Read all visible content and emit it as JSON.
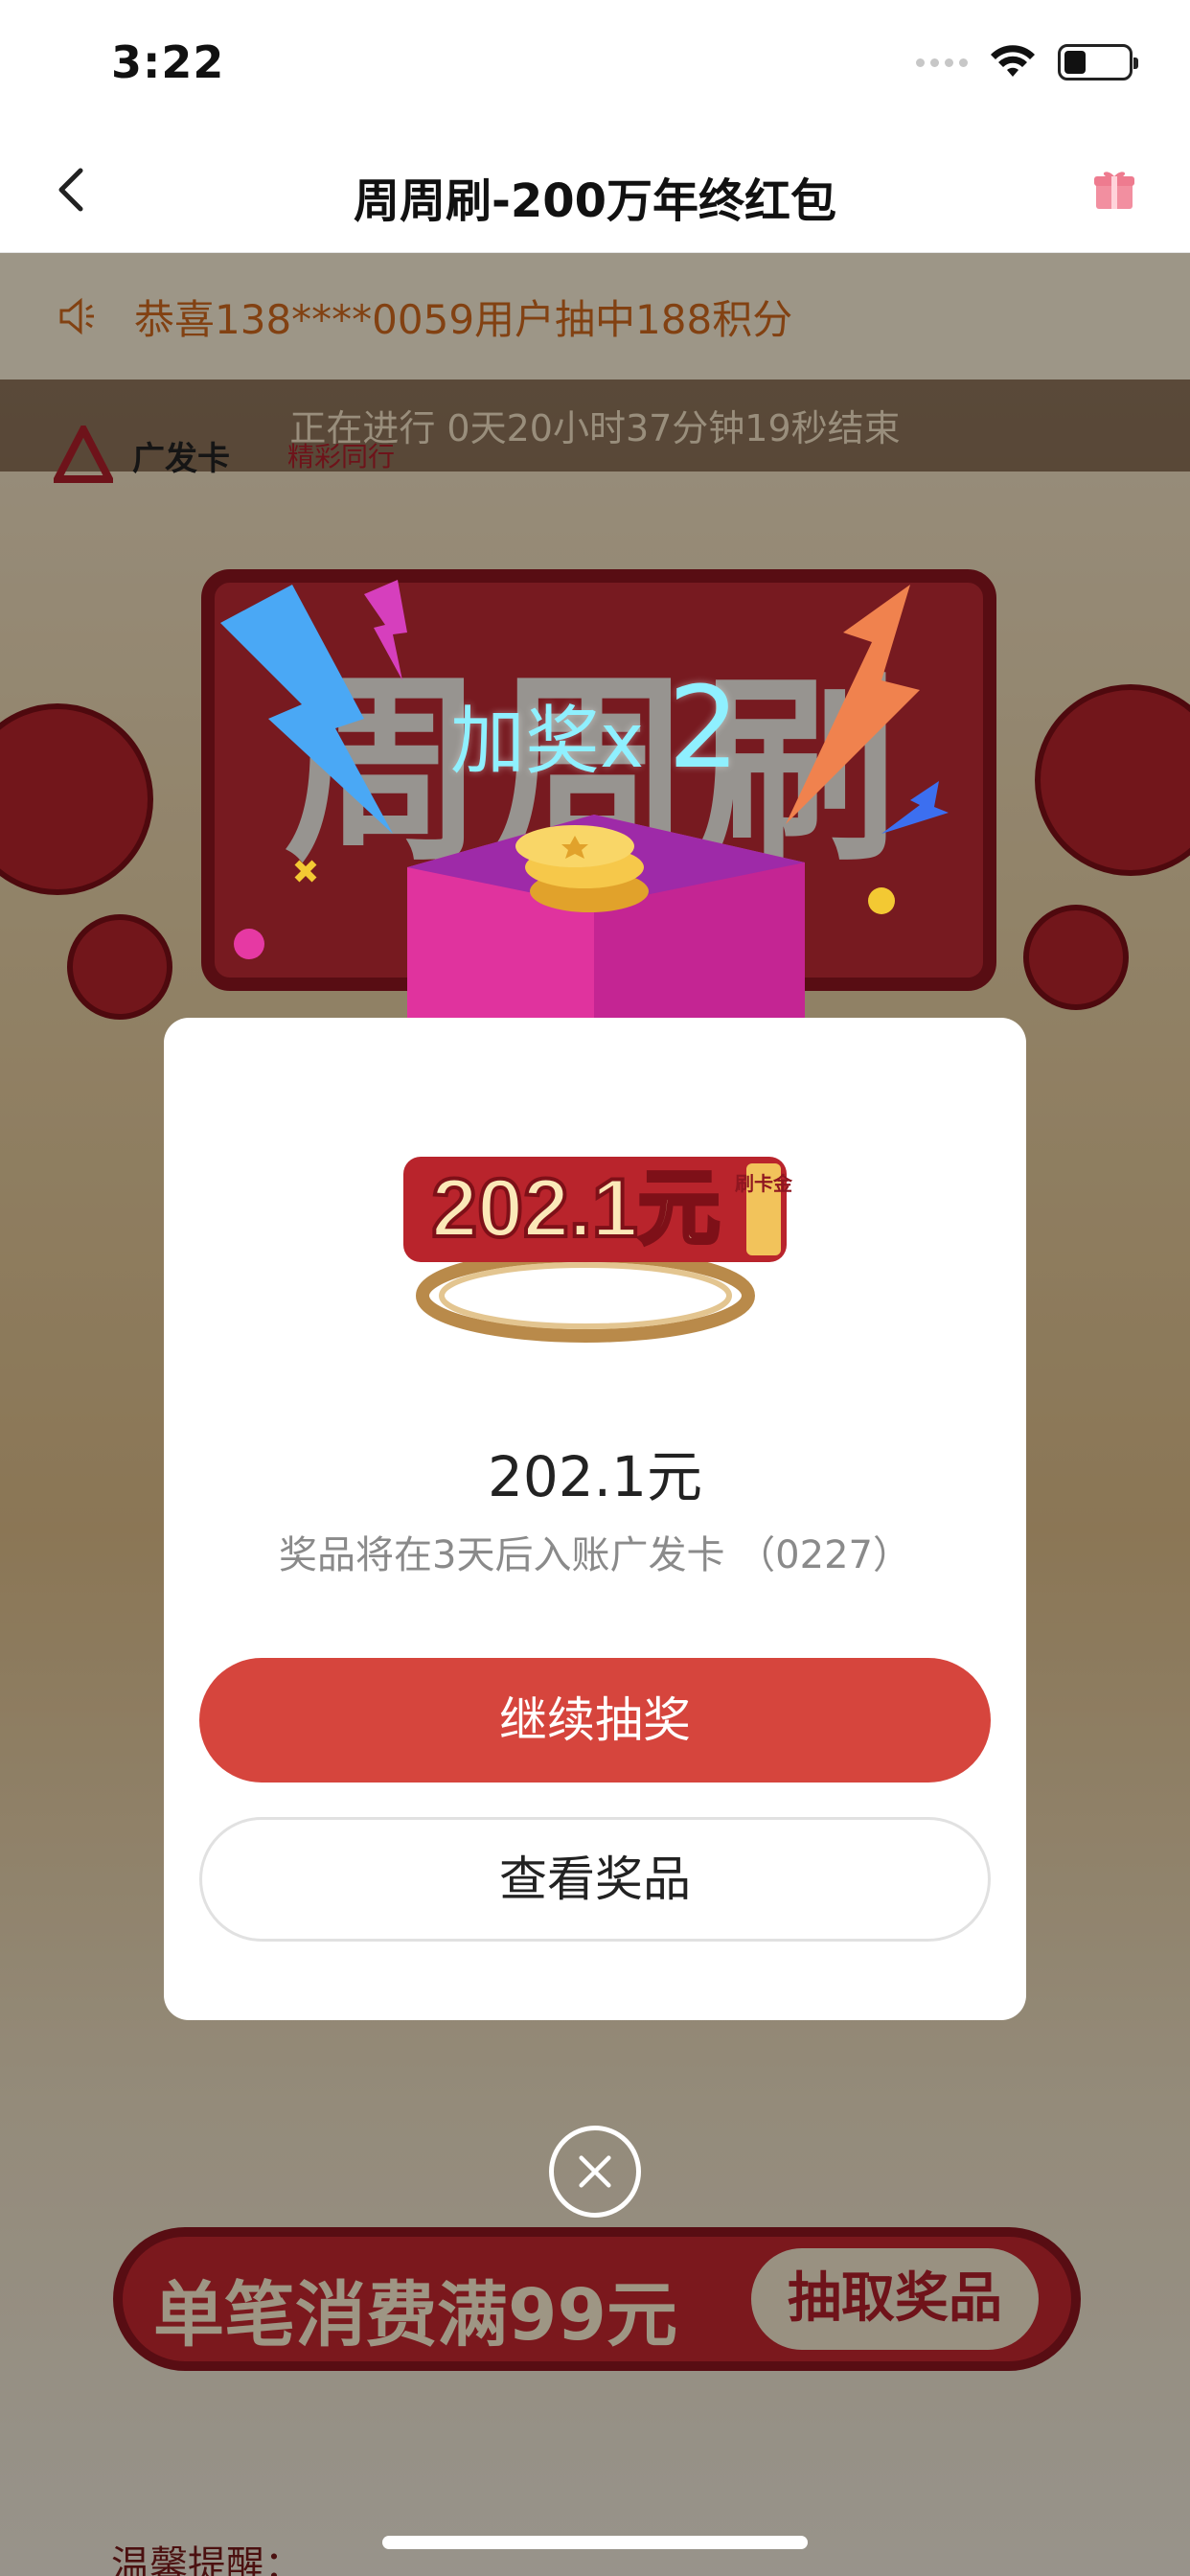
{
  "status_bar": {
    "time": "3:22",
    "icons": [
      "signal-icon",
      "wifi-icon",
      "battery-icon"
    ]
  },
  "nav": {
    "title": "周周刷-200万年终红包",
    "back_icon": "chevron-left-icon",
    "gift_icon": "gift-icon"
  },
  "notice": {
    "icon": "speaker-icon",
    "text": "恭喜138****0059用户抽中188积分"
  },
  "countdown": {
    "text": "正在进行 0天20小时37分钟19秒结束"
  },
  "brand": {
    "name": "广发卡",
    "tagline": "精彩同行"
  },
  "hero": {
    "title": "周周刷"
  },
  "bonus": {
    "label": "加奖x",
    "multiplier": "2"
  },
  "modal": {
    "prize_art_text": "202.1元",
    "prize_art_badge": "刷卡金",
    "prize_amount": "202.1元",
    "prize_note": "奖品将在3天后入账广发卡 （0227）",
    "continue_label": "继续抽奖",
    "view_label": "查看奖品"
  },
  "bottom_banner": {
    "text": "单笔消费满99元",
    "button": "抽取奖品"
  },
  "reminder": {
    "text": "温馨提醒："
  },
  "colors": {
    "accent_red": "#d6453d",
    "notice_orange": "#d2691e",
    "bonus_cyan": "#8ff0ff"
  }
}
